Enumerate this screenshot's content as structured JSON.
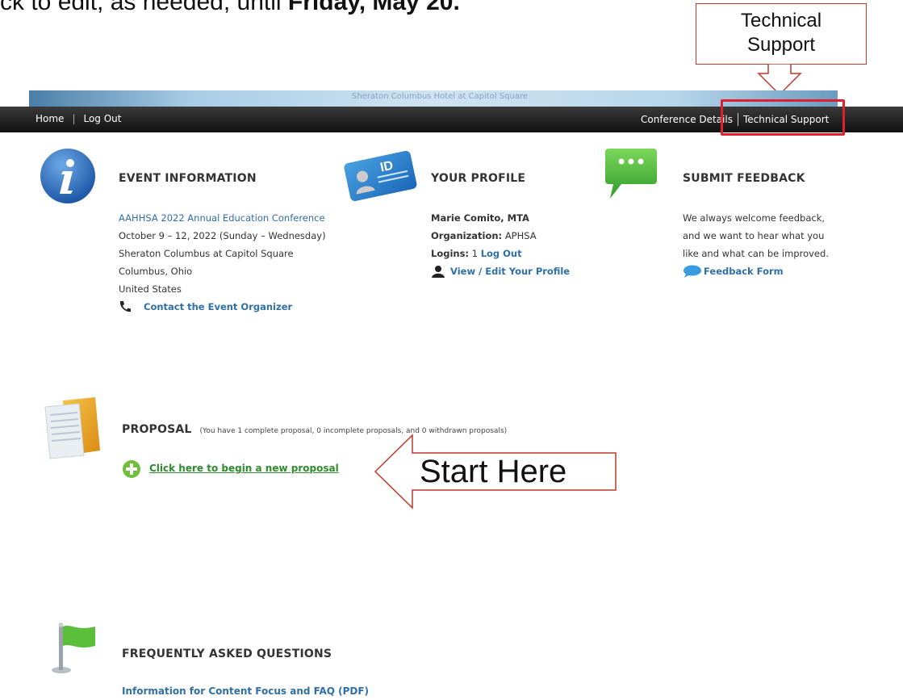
{
  "instruction": {
    "prefix": "ck to edit, as needed, until ",
    "bold": "Friday, May 20."
  },
  "callouts": {
    "technical_support_line1": "Technical",
    "technical_support_line2": "Support",
    "start_here": "Start Here",
    "arrow_color": "#c0392b",
    "highlight_color": "#e0202e"
  },
  "banner": {
    "text": "Sheraton Columbus Hotel at Capitol Square"
  },
  "nav": {
    "home": "Home",
    "separator": "|",
    "logout": "Log Out",
    "conference_details": "Conference Details",
    "technical_support": "Technical Support"
  },
  "event_info": {
    "heading": "EVENT INFORMATION",
    "conference_link": "AAHHSA 2022 Annual Education Conference",
    "dates": "October 9 – 12, 2022 (Sunday – Wednesday)",
    "venue": "Sheraton Columbus at Capitol Square",
    "city": "Columbus, Ohio",
    "country": "United States",
    "contact_link": "Contact the Event Organizer",
    "icon": "info-icon",
    "phone_icon": "phone-icon"
  },
  "profile": {
    "heading": "YOUR PROFILE",
    "name": "Marie Comito, MTA",
    "org_label": "Organization:",
    "org_value": "APHSA",
    "logins_label": "Logins:",
    "logins_value": "1",
    "logout_link": "Log Out",
    "edit_link": "View / Edit Your Profile",
    "id_text": "ID",
    "icon": "id-card-icon",
    "user_icon": "user-icon"
  },
  "feedback": {
    "heading": "SUBMIT FEEDBACK",
    "line1": "We always welcome feedback,",
    "line2": "and we want to hear what you",
    "line3": "like and what can be improved.",
    "form_link": "Feedback Form",
    "icon": "chat-bubble-icon"
  },
  "proposal": {
    "heading": "PROPOSAL",
    "note": "(You have 1 complete proposal, 0 incomplete proposals, and 0 withdrawn proposals)",
    "new_link": "Click here to begin a new proposal",
    "icon": "folder-icon",
    "add_icon": "plus-circle-icon"
  },
  "faq": {
    "heading": "FREQUENTLY ASKED QUESTIONS",
    "link": "Information for Content Focus and FAQ (PDF)",
    "icon": "flag-icon"
  }
}
